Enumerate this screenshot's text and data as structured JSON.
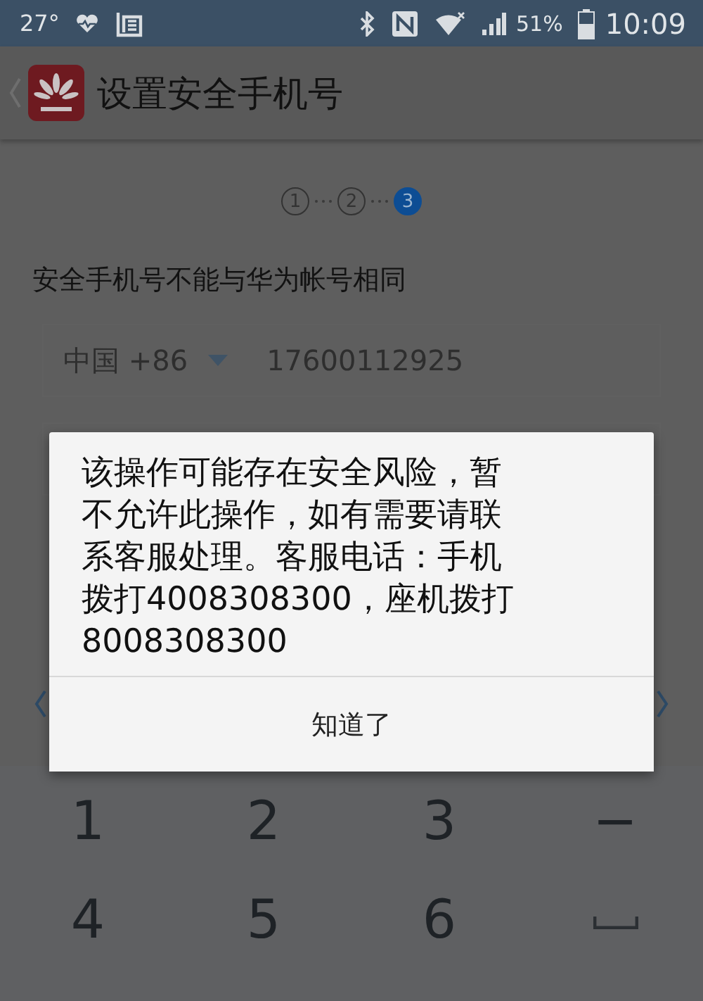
{
  "status_bar": {
    "temperature": "27°",
    "battery_percent": "51%",
    "time": "10:09"
  },
  "app_bar": {
    "title": "设置安全手机号"
  },
  "steps": [
    {
      "label": "1",
      "selected": false
    },
    {
      "label": "2",
      "selected": false
    },
    {
      "label": "3",
      "selected": true
    }
  ],
  "notice": "安全手机号不能与华为帐号相同",
  "phone_field": {
    "country_code": "中国 +86",
    "value": "17600112925"
  },
  "dialog": {
    "message": "该操作可能存在安全风险，暂不允许此操作，如有需要请联系客服处理。客服电话：手机拨打4008308300，座机拨打8008308300",
    "button": "知道了"
  },
  "keypad": {
    "rows": [
      [
        {
          "kind": "char",
          "label": "1"
        },
        {
          "kind": "char",
          "label": "2"
        },
        {
          "kind": "char",
          "label": "3"
        },
        {
          "kind": "char",
          "label": "−"
        }
      ],
      [
        {
          "kind": "char",
          "label": "4"
        },
        {
          "kind": "char",
          "label": "5"
        },
        {
          "kind": "char",
          "label": "6"
        },
        {
          "kind": "space"
        }
      ]
    ]
  }
}
